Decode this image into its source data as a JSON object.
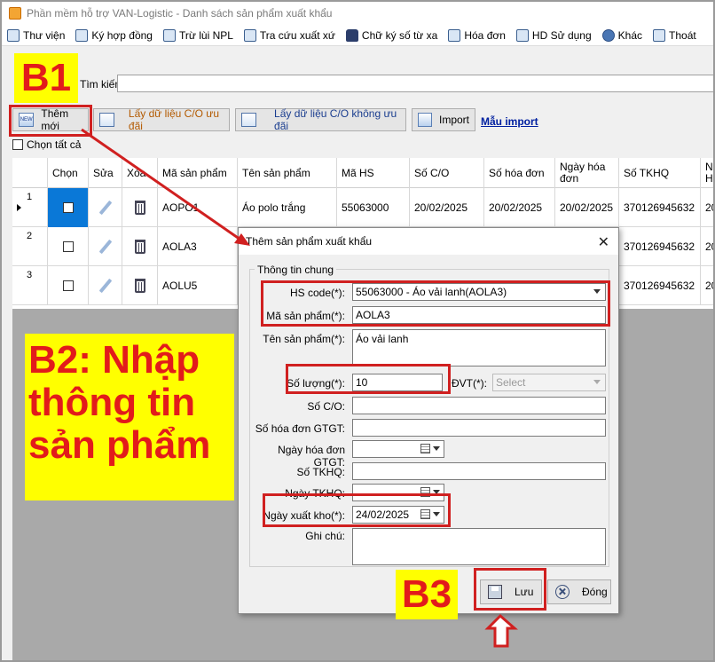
{
  "window": {
    "title": "Phần mềm hỗ trợ VAN-Logistic - Danh sách sản phẩm xuất khẩu"
  },
  "menu": [
    {
      "label": "Thư viện",
      "icon": "library-icon"
    },
    {
      "label": "Ký hợp đồng",
      "icon": "sign-contract-icon"
    },
    {
      "label": "Trừ lùi NPL",
      "icon": "deduct-icon"
    },
    {
      "label": "Tra cứu xuất xứ",
      "icon": "lookup-origin-icon"
    },
    {
      "label": "Chữ ký số từ xa",
      "icon": "lock-icon"
    },
    {
      "label": "Hóa đơn",
      "icon": "invoice-icon"
    },
    {
      "label": "HD Sử dụng",
      "icon": "help-icon"
    },
    {
      "label": "Khác",
      "icon": "gear-icon"
    },
    {
      "label": "Thoát",
      "icon": "exit-icon"
    }
  ],
  "search": {
    "label": "Tìm kiếm:",
    "value": ""
  },
  "toolbar": {
    "add_new": "Thêm mới",
    "new_icon_text": "NEW",
    "get_co_preferential": "Lấy dữ liệu C/O ưu đãi",
    "get_co_non_preferential": "Lấy dữ liệu C/O không ưu đãi",
    "import": "Import",
    "import_template": "Mẫu import"
  },
  "select_all": "Chọn tất cả",
  "grid": {
    "columns": [
      "Chọn",
      "Sửa",
      "Xóa",
      "Mã sản phẩm",
      "Tên sản phẩm",
      "Mã HS",
      "Số C/O",
      "Số hóa đơn",
      "Ngày hóa đơn",
      "Số TKHQ",
      "N H"
    ],
    "rows": [
      {
        "num": "1",
        "code": "AOPO1",
        "name": "Áo polo trắng",
        "hs": "55063000",
        "co": "20/02/2025",
        "invoice_no": "20/02/2025",
        "invoice_date": "20/02/2025",
        "tkhq": "370126945632",
        "extra": "20"
      },
      {
        "num": "2",
        "code": "AOLA3",
        "name": "",
        "hs": "",
        "co": "",
        "invoice_no": "",
        "invoice_date": "",
        "tkhq": "370126945632",
        "extra": "20"
      },
      {
        "num": "3",
        "code": "AOLU5",
        "name": "",
        "hs": "",
        "co": "",
        "invoice_no": "",
        "invoice_date": "",
        "tkhq": "370126945632",
        "extra": "20"
      }
    ]
  },
  "dialog": {
    "title": "Thêm sản phẩm xuất khẩu",
    "group": "Thông tin chung",
    "fields": {
      "hs_code": {
        "label": "HS code(*):",
        "value": "55063000 - Áo vải lanh(AOLA3)"
      },
      "product_code": {
        "label": "Mã sản phẩm(*):",
        "value": "AOLA3"
      },
      "product_name": {
        "label": "Tên sản phẩm(*):",
        "value": "Áo vải lanh"
      },
      "quantity": {
        "label": "Số lượng(*):",
        "value": "10"
      },
      "unit": {
        "label": "ĐVT(*):",
        "value": "Select"
      },
      "co_number": {
        "label": "Số C/O:",
        "value": ""
      },
      "vat_invoice_no": {
        "label": "Số hóa đơn GTGT:",
        "value": ""
      },
      "vat_invoice_date": {
        "label": "Ngày hóa đơn GTGT:",
        "value": ""
      },
      "tkhq": {
        "label": "Số TKHQ:",
        "value": ""
      },
      "tkhq_date": {
        "label": "Ngày TKHQ:",
        "value": ""
      },
      "export_date": {
        "label": "Ngày xuất kho(*):",
        "value": "24/02/2025"
      },
      "notes": {
        "label": "Ghi chú:",
        "value": ""
      }
    },
    "save": "Lưu",
    "close": "Đóng"
  },
  "annotations": {
    "b1": "B1",
    "b2": "B2: Nhập thông tin sản phẩm",
    "b3": "B3",
    "color_red": "#d02020",
    "color_yellow": "#ffff00"
  }
}
